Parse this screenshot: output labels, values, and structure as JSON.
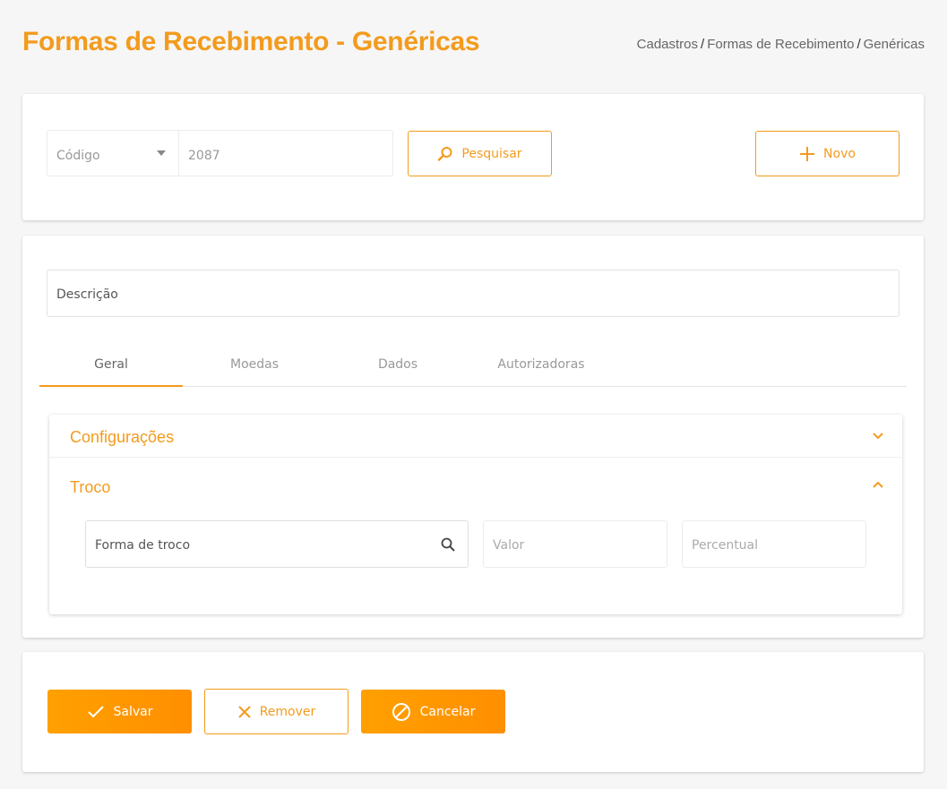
{
  "header": {
    "title": "Formas de Recebimento - Genéricas",
    "breadcrumb": [
      "Cadastros",
      "Formas de Recebimento",
      "Genéricas"
    ],
    "separator": "/"
  },
  "search": {
    "filter_label": "Código",
    "filter_value": "2087",
    "search_label": "Pesquisar",
    "new_label": "Novo"
  },
  "form": {
    "description_placeholder": "Descrição",
    "tabs": [
      {
        "label": "Geral",
        "active": true
      },
      {
        "label": "Moedas",
        "active": false
      },
      {
        "label": "Dados",
        "active": false
      },
      {
        "label": "Autorizadoras",
        "active": false
      }
    ],
    "sections": [
      {
        "title": "Configurações",
        "expanded": false
      },
      {
        "title": "Troco",
        "expanded": true
      }
    ],
    "troco": {
      "forma_label": "Forma de troco",
      "valor_placeholder": "Valor",
      "percentual_placeholder": "Percentual"
    }
  },
  "actions": {
    "save_label": "Salvar",
    "remove_label": "Remover",
    "cancel_label": "Cancelar"
  },
  "colors": {
    "accent": "#f39b1d",
    "button_fill": "#ffa000"
  },
  "icons": {
    "search": "search-icon",
    "new": "plus-icon",
    "save": "check-icon",
    "remove": "close-icon",
    "cancel": "block-icon"
  }
}
